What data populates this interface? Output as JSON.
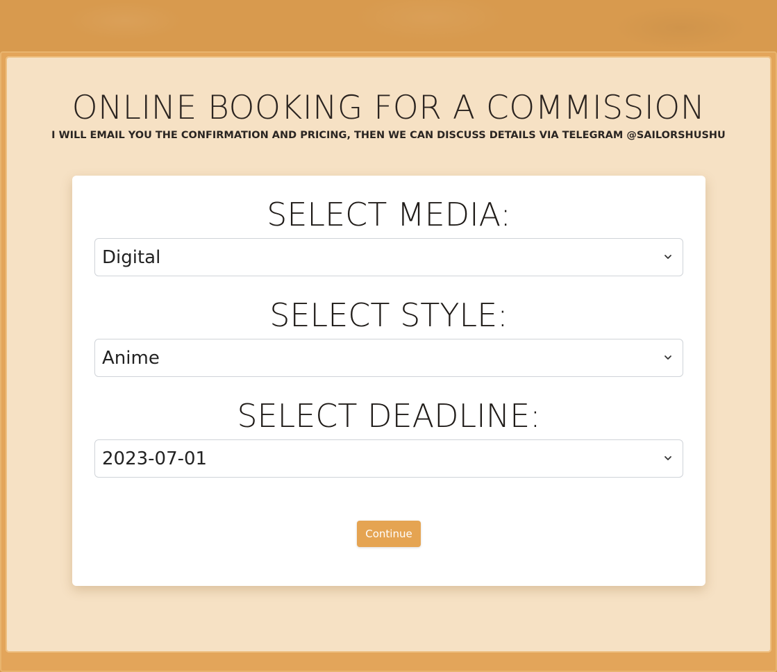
{
  "header": {
    "title": "ONLINE BOOKING FOR A COMMISSION",
    "subtitle": "I WILL EMAIL YOU THE CONFIRMATION AND PRICING, THEN WE CAN DISCUSS DETAILS VIA TELEGRAM @SAILORSHUSHU"
  },
  "form": {
    "media": {
      "label": "SELECT MEDIA:",
      "value": "Digital"
    },
    "style": {
      "label": "SELECT STYLE:",
      "value": "Anime"
    },
    "deadline": {
      "label": "SELECT DEADLINE:",
      "value": "2023-07-01"
    },
    "continue_label": "Continue"
  },
  "icons": {
    "dropdown": "chevron-down-icon"
  },
  "colors": {
    "background": "#d89a4e",
    "panel": "#f6e1c4",
    "card": "#ffffff",
    "accent": "#e5a452"
  }
}
